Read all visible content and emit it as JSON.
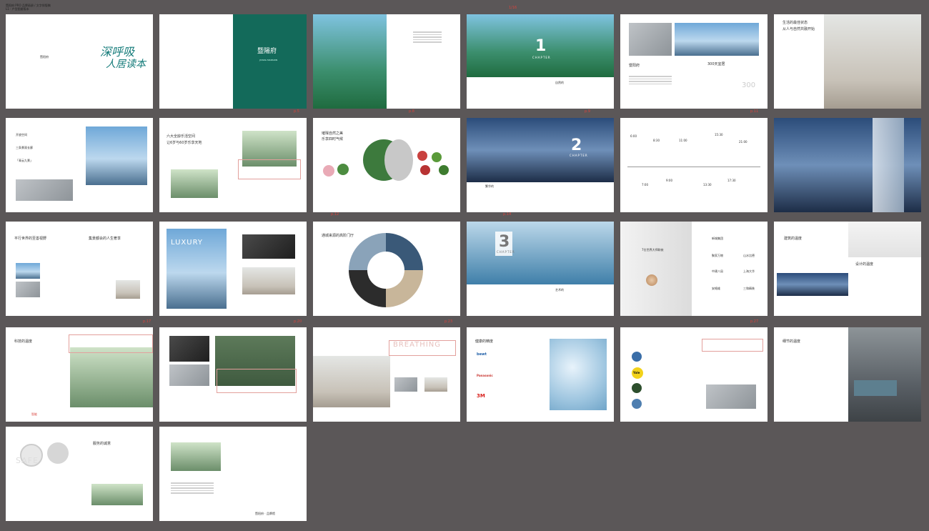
{
  "header_note": {
    "line1": "暨阳府 PRO 品牌画册 / 文字排版稿",
    "line2": "L1 · 户型图册版本"
  },
  "markers": [
    "1/16",
    "p.5",
    "p.8",
    "p.9",
    "p.11",
    "p.12",
    "p.14",
    "p.17",
    "p.20",
    "p.23",
    "p.27"
  ],
  "pages": {
    "p1": {
      "slogan": "深呼吸",
      "slogan2": "人居读本",
      "small": "暨阳府"
    },
    "p2": {
      "title": "暨陽府",
      "sub": "JIYANG MANSION"
    },
    "p4": {
      "num": "1",
      "chapter": "CHAPTER",
      "caption": "自然的"
    },
    "p5": {
      "title": "暨阳府",
      "caption": "300天宜居",
      "num": "300"
    },
    "p6": {
      "title": "生活的最佳状态",
      "title2": "从人与自然共融开始"
    },
    "p7": {
      "l1": "开放空间",
      "l2": "三条景观长廊",
      "l3": "「青云九景」"
    },
    "p8": {
      "title": "六大全龄乐活空间",
      "title2": "让6岁与60岁乐享天地"
    },
    "p9": {
      "title": "璀璨自然之美",
      "title2": "乐享四时气候"
    },
    "p10": {
      "num": "2",
      "chapter": "CHAPTER",
      "caption": "繁华的"
    },
    "p11": {
      "times": [
        "6:00",
        "8:30",
        "11:00",
        "15:30",
        "21:00",
        "7:00",
        "9:00",
        "13:30",
        "17:30"
      ]
    },
    "p13": {
      "title": "平行世界的至善视野",
      "title2": "集景都会的人生奢享"
    },
    "p14": {
      "word": "LUXURY"
    },
    "p15": {
      "title": "通城来源的高阶门厅"
    },
    "p16": {
      "num": "3",
      "chapter": "CHAPTER",
      "caption": "艺术的"
    },
    "p17": {
      "title": "7位世界大师联袂",
      "n1": "新城集团",
      "n2": "聚家万物",
      "n3": "山水比德",
      "n4": "中建八局",
      "n5": "上海大华",
      "n6": "安格维",
      "n7": "三和精装"
    },
    "p18": {
      "title": "建筑的温度",
      "title2": "设计的温度"
    },
    "p19": {
      "title": "科技的温度",
      "caption": "智能"
    },
    "p21": {
      "word": "BREATHING"
    },
    "p22": {
      "title": "健康的精度",
      "brand1": "bewt",
      "brand2": "Panasonic",
      "brand3": "3M"
    },
    "p23": {
      "brand": "Yale"
    },
    "p24": {
      "title": "细节的温度"
    },
    "p25": {
      "word": "SAFE",
      "title": "服务的诚意"
    },
    "p26": {
      "logo": "暨阳府 · 品牌馆"
    }
  }
}
